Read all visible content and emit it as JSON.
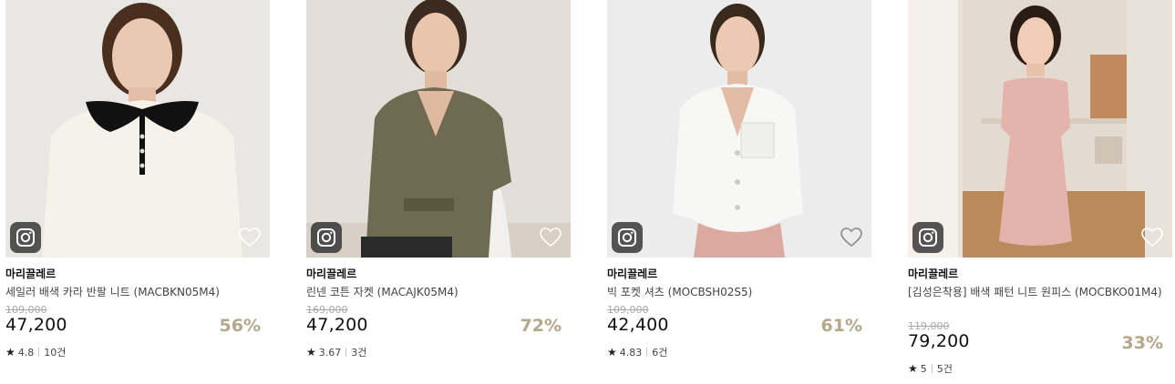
{
  "products": [
    {
      "brand": "마리끌레르",
      "name": "세일러 배색 카라 반팔 니트 (MACBKN05M4)",
      "original_price": "109,000",
      "price": "47,200",
      "discount": "56%",
      "rating": "4.8",
      "reviews": "10건",
      "photo": {
        "bg": "#e9e7e4",
        "garment": "#f5f2ea",
        "accent": "#111111"
      }
    },
    {
      "brand": "마리끌레르",
      "name": "린넨 코튼 자켓 (MACAJK05M4)",
      "original_price": "169,000",
      "price": "47,200",
      "discount": "72%",
      "rating": "3.67",
      "reviews": "3건",
      "photo": {
        "bg": "#e3ded8",
        "garment": "#6f6a52",
        "accent": "#2a2a2a"
      }
    },
    {
      "brand": "마리끌레르",
      "name": "빅 포켓 셔츠 (MOCBSH02S5)",
      "original_price": "109,000",
      "price": "42,400",
      "discount": "61%",
      "rating": "4.83",
      "reviews": "6건",
      "photo": {
        "bg": "#ececec",
        "garment": "#f7f7f5",
        "accent": "#dba9a0"
      }
    },
    {
      "brand": "마리끌레르",
      "name": "[김성은착용] 배색 패턴 니트 원피스 (MOCBKO01M4)",
      "original_price": "119,000",
      "price": "79,200",
      "discount": "33%",
      "rating": "5",
      "reviews": "5건",
      "photo": {
        "bg": "#e8e2da",
        "garment": "#e4b4ac",
        "accent": "#c08a5a"
      }
    }
  ],
  "icons": {
    "instagram": "instagram-icon",
    "wishlist": "heart-outline-icon",
    "rating": "star-icon"
  },
  "colors": {
    "discount": "#b5a78a",
    "strike": "#a8a8a8",
    "text": "#111111"
  }
}
